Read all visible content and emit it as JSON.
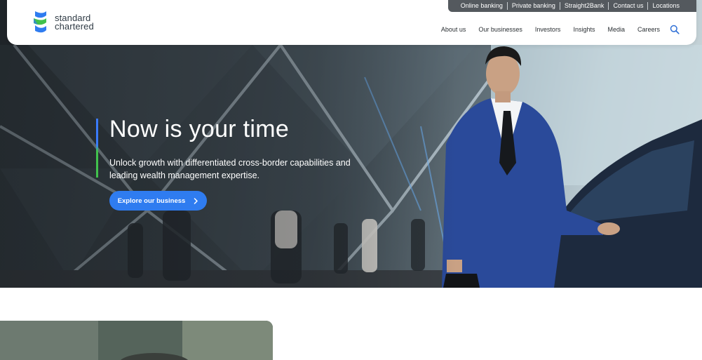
{
  "header": {
    "logo": {
      "line1": "standard",
      "line2": "chartered"
    },
    "utility_links": [
      "Online banking",
      "Private banking",
      "Straight2Bank",
      "Contact us",
      "Locations"
    ],
    "nav_links": [
      "About us",
      "Our businesses",
      "Investors",
      "Insights",
      "Media",
      "Careers"
    ],
    "search_icon": "search-icon"
  },
  "hero": {
    "title": "Now is your time",
    "subtitle": "Unlock growth with differentiated cross-border capabilities and leading wealth management expertise.",
    "cta_label": "Explore our business",
    "cta_icon": "chevron-right-icon"
  },
  "colors": {
    "brand_blue": "#2f7cf0",
    "brand_green": "#41c24d",
    "utility_bar": "#54595e"
  }
}
